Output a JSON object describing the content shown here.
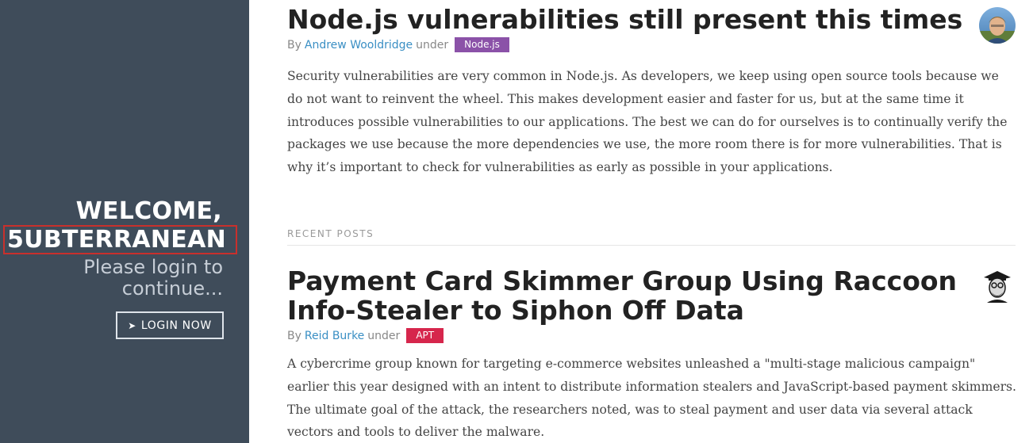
{
  "sidebar": {
    "welcome": "WELCOME,",
    "username": "5UBTERRANEAN",
    "subtitle": "Please login to continue...",
    "login_arrow": "➤",
    "login_label": "LOGIN NOW"
  },
  "featured_post": {
    "title": "Node.js vulnerabilities still present this times",
    "by": "By",
    "author": "Andrew Wooldridge",
    "under": "under",
    "tag": "Node.js",
    "body": "Security vulnerabilities are very common in Node.js. As developers, we keep using open source tools because we do not want to reinvent the wheel. This makes development easier and faster for us, but at the same time it introduces possible vulnerabilities to our applications. The best we can do for ourselves is to continually verify the packages we use because the more dependencies we use, the more room there is for more vulnerabilities. That is why it’s important to check for vulnerabilities as early as possible in your applications."
  },
  "recent_posts": {
    "label": "RECENT POSTS",
    "posts": [
      {
        "title": "Payment Card Skimmer Group Using Raccoon Info-Stealer to Siphon Off Data",
        "by": "By",
        "author": "Reid Burke",
        "under": "under",
        "tag": "APT",
        "body": "A cybercrime group known for targeting e-commerce websites unleashed a \"multi-stage malicious campaign\" earlier this year designed with an intent to distribute information stealers and JavaScript-based payment skimmers. The ultimate goal of the attack, the researchers noted, was to steal payment and user data via several attack vectors and tools to deliver the malware."
      }
    ]
  },
  "colors": {
    "sidebar_bg": "#3f4c5a",
    "link": "#3a8fc4",
    "tag_nodejs": "#8b52a8",
    "tag_apt": "#d6264c",
    "highlight_border": "#c9302c"
  }
}
